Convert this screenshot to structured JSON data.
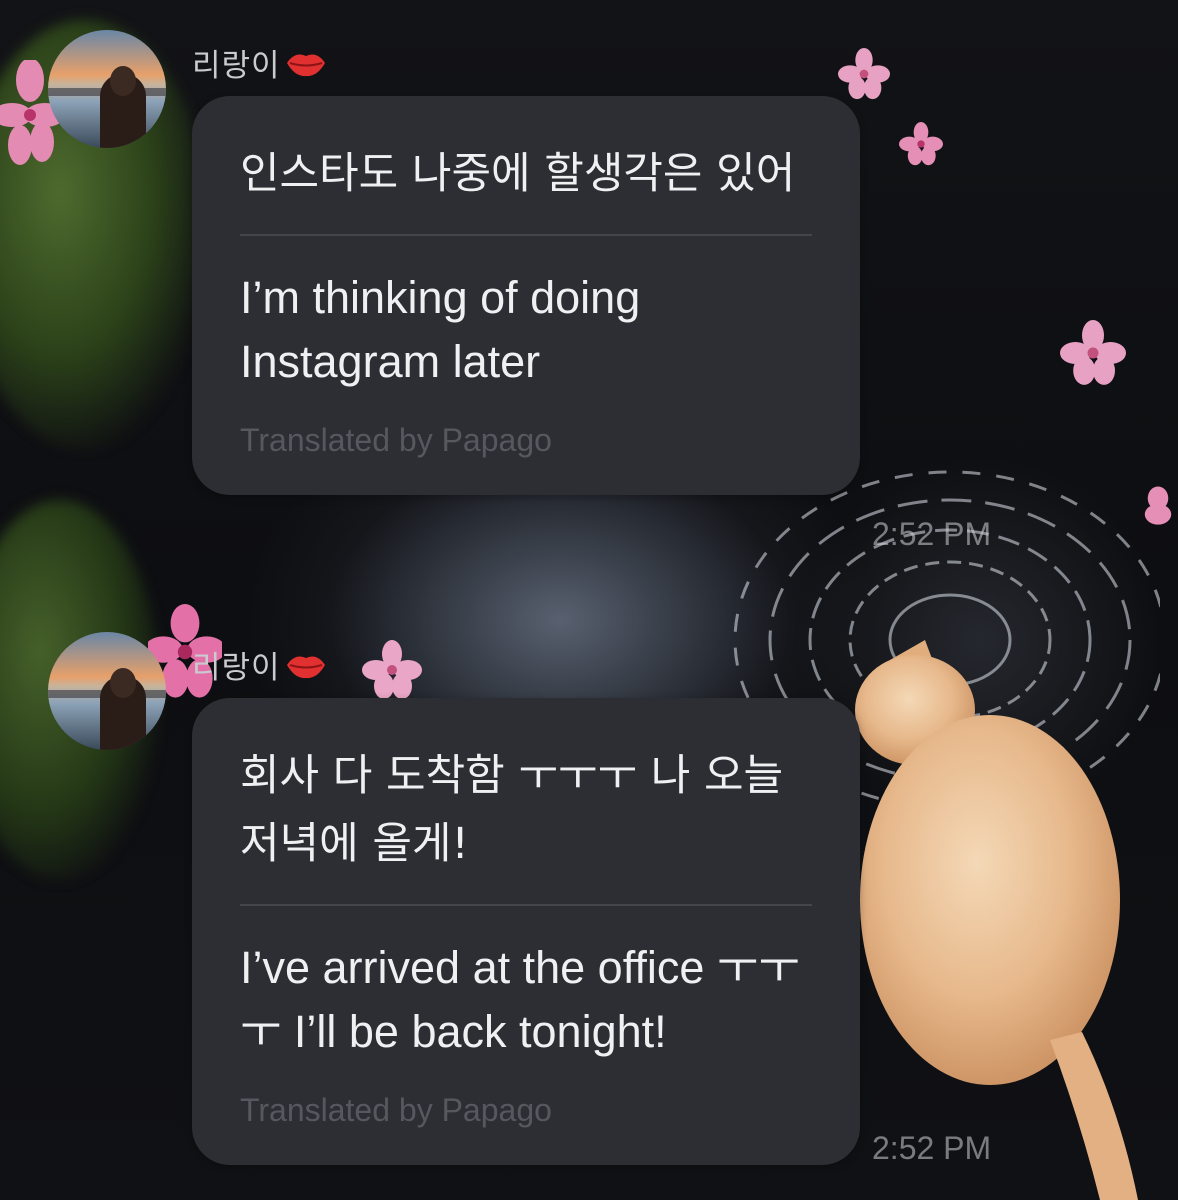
{
  "messages": [
    {
      "sender": "리랑이",
      "original": "인스타도 나중에 할생각은 있어",
      "translation": "I’m thinking of doing Instagram later",
      "translated_by": "Translated by Papago",
      "time": "2:52 PM"
    },
    {
      "sender": "리랑이",
      "original": "회사 다 도착함 ㅜㅜㅜ 나 오늘 저녁에 올게!",
      "translation": "I’ve arrived at the office ㅜㅜㅜ I’ll be back tonight!",
      "translated_by": "Translated by Papago",
      "time": "2:52 PM"
    }
  ],
  "icons": {
    "sender_badge": "kiss-lips-icon"
  },
  "colors": {
    "bubble": "#2d2e34",
    "text": "#eef0f2",
    "muted": "#55585f",
    "lips": "#e0302f"
  }
}
